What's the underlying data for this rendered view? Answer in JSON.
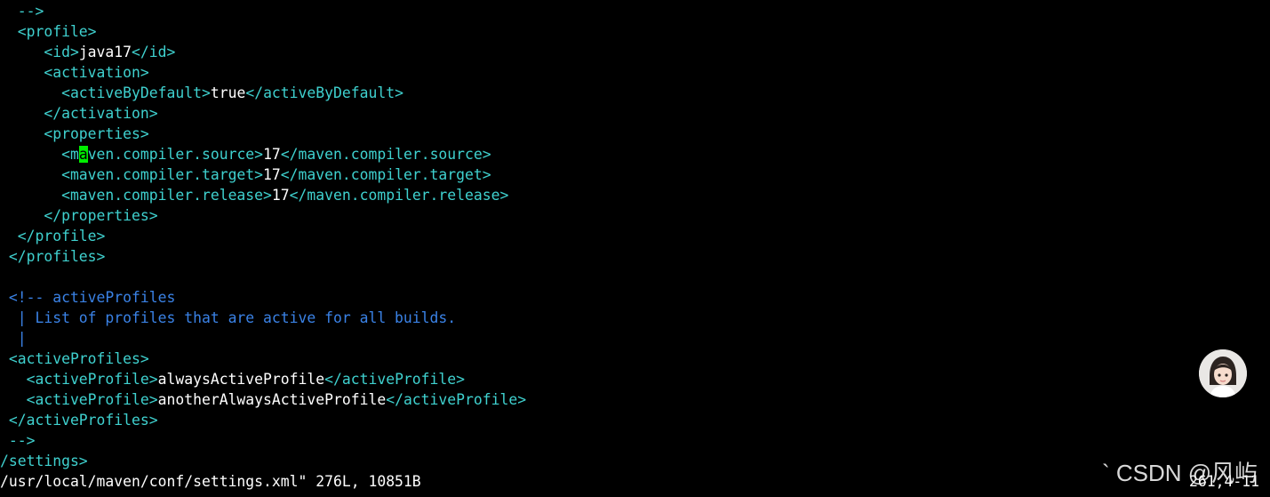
{
  "lines": [
    {
      "segments": [
        {
          "cls": "tag",
          "text": "  -->"
        }
      ]
    },
    {
      "segments": [
        {
          "cls": "tag",
          "text": "  <profile>"
        }
      ]
    },
    {
      "segments": [
        {
          "cls": "tag",
          "text": "     <id>"
        },
        {
          "cls": "text",
          "text": "java17"
        },
        {
          "cls": "tag",
          "text": "</id>"
        }
      ]
    },
    {
      "segments": [
        {
          "cls": "tag",
          "text": "     <activation>"
        }
      ]
    },
    {
      "segments": [
        {
          "cls": "tag",
          "text": "       <activeByDefault>"
        },
        {
          "cls": "text",
          "text": "true"
        },
        {
          "cls": "tag",
          "text": "</activeByDefault>"
        }
      ]
    },
    {
      "segments": [
        {
          "cls": "tag",
          "text": "     </activation>"
        }
      ]
    },
    {
      "segments": [
        {
          "cls": "tag",
          "text": "     <properties>"
        }
      ]
    },
    {
      "segments": [
        {
          "cls": "tag",
          "text": "       <m"
        },
        {
          "cls": "cursor",
          "text": "a"
        },
        {
          "cls": "tag",
          "text": "ven.compiler.source>"
        },
        {
          "cls": "text",
          "text": "17"
        },
        {
          "cls": "tag",
          "text": "</maven.compiler.source>"
        }
      ]
    },
    {
      "segments": [
        {
          "cls": "tag",
          "text": "       <maven.compiler.target>"
        },
        {
          "cls": "text",
          "text": "17"
        },
        {
          "cls": "tag",
          "text": "</maven.compiler.target>"
        }
      ]
    },
    {
      "segments": [
        {
          "cls": "tag",
          "text": "       <maven.compiler.release>"
        },
        {
          "cls": "text",
          "text": "17"
        },
        {
          "cls": "tag",
          "text": "</maven.compiler.release>"
        }
      ]
    },
    {
      "segments": [
        {
          "cls": "tag",
          "text": "     </properties>"
        }
      ]
    },
    {
      "segments": [
        {
          "cls": "tag",
          "text": "  </profile>"
        }
      ]
    },
    {
      "segments": [
        {
          "cls": "tag",
          "text": " </profiles>"
        }
      ]
    },
    {
      "segments": []
    },
    {
      "segments": [
        {
          "cls": "comment",
          "text": " <!-- activeProfiles"
        }
      ]
    },
    {
      "segments": [
        {
          "cls": "comment",
          "text": "  | List of profiles that are active for all builds."
        }
      ]
    },
    {
      "segments": [
        {
          "cls": "comment",
          "text": "  |"
        }
      ]
    },
    {
      "segments": [
        {
          "cls": "tag",
          "text": " <activeProfiles>"
        }
      ]
    },
    {
      "segments": [
        {
          "cls": "tag",
          "text": "   <activeProfile>"
        },
        {
          "cls": "text",
          "text": "alwaysActiveProfile"
        },
        {
          "cls": "tag",
          "text": "</activeProfile>"
        }
      ]
    },
    {
      "segments": [
        {
          "cls": "tag",
          "text": "   <activeProfile>"
        },
        {
          "cls": "text",
          "text": "anotherAlwaysActiveProfile"
        },
        {
          "cls": "tag",
          "text": "</activeProfile>"
        }
      ]
    },
    {
      "segments": [
        {
          "cls": "tag",
          "text": " </activeProfiles>"
        }
      ]
    },
    {
      "segments": [
        {
          "cls": "tag",
          "text": " -->"
        }
      ]
    },
    {
      "segments": [
        {
          "cls": "tag",
          "text": "/settings>"
        }
      ]
    }
  ],
  "status": {
    "message": "/usr/local/maven/conf/settings.xml\" 276L, 10851B",
    "ruler": "261,4-11"
  },
  "watermark": "` CSDN @风屿"
}
